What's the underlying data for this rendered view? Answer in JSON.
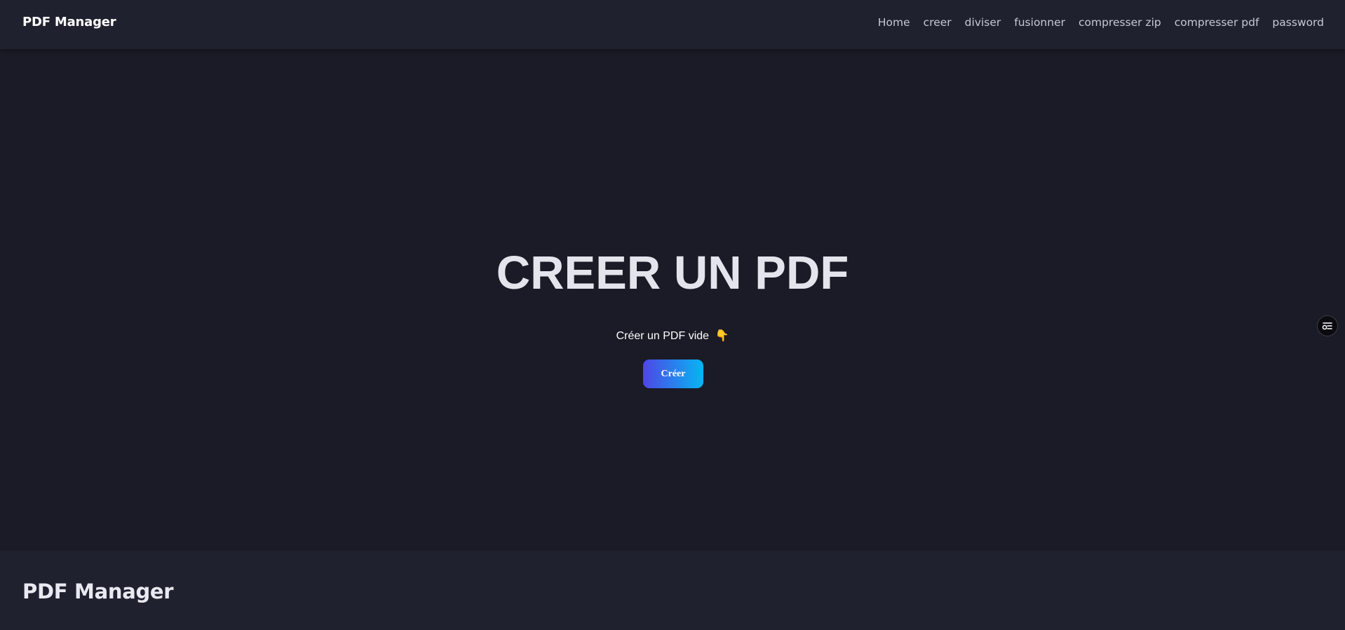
{
  "header": {
    "brand": "PDF Manager",
    "nav": [
      {
        "label": "Home"
      },
      {
        "label": "creer"
      },
      {
        "label": "diviser"
      },
      {
        "label": "fusionner"
      },
      {
        "label": "compresser zip"
      },
      {
        "label": "compresser pdf"
      },
      {
        "label": "password"
      }
    ]
  },
  "main": {
    "title": "CREER UN PDF",
    "subtitle": "Créer un PDF vide",
    "subtitle_emoji": "👇",
    "button_label": "Créer"
  },
  "footer": {
    "brand": "PDF Manager"
  },
  "widget": {
    "icon": "settings-list-icon"
  },
  "colors": {
    "background": "#1a1b26",
    "navbar": "#20212f",
    "button_gradient_start": "#4f46e5",
    "button_gradient_end": "#06b6f4"
  }
}
